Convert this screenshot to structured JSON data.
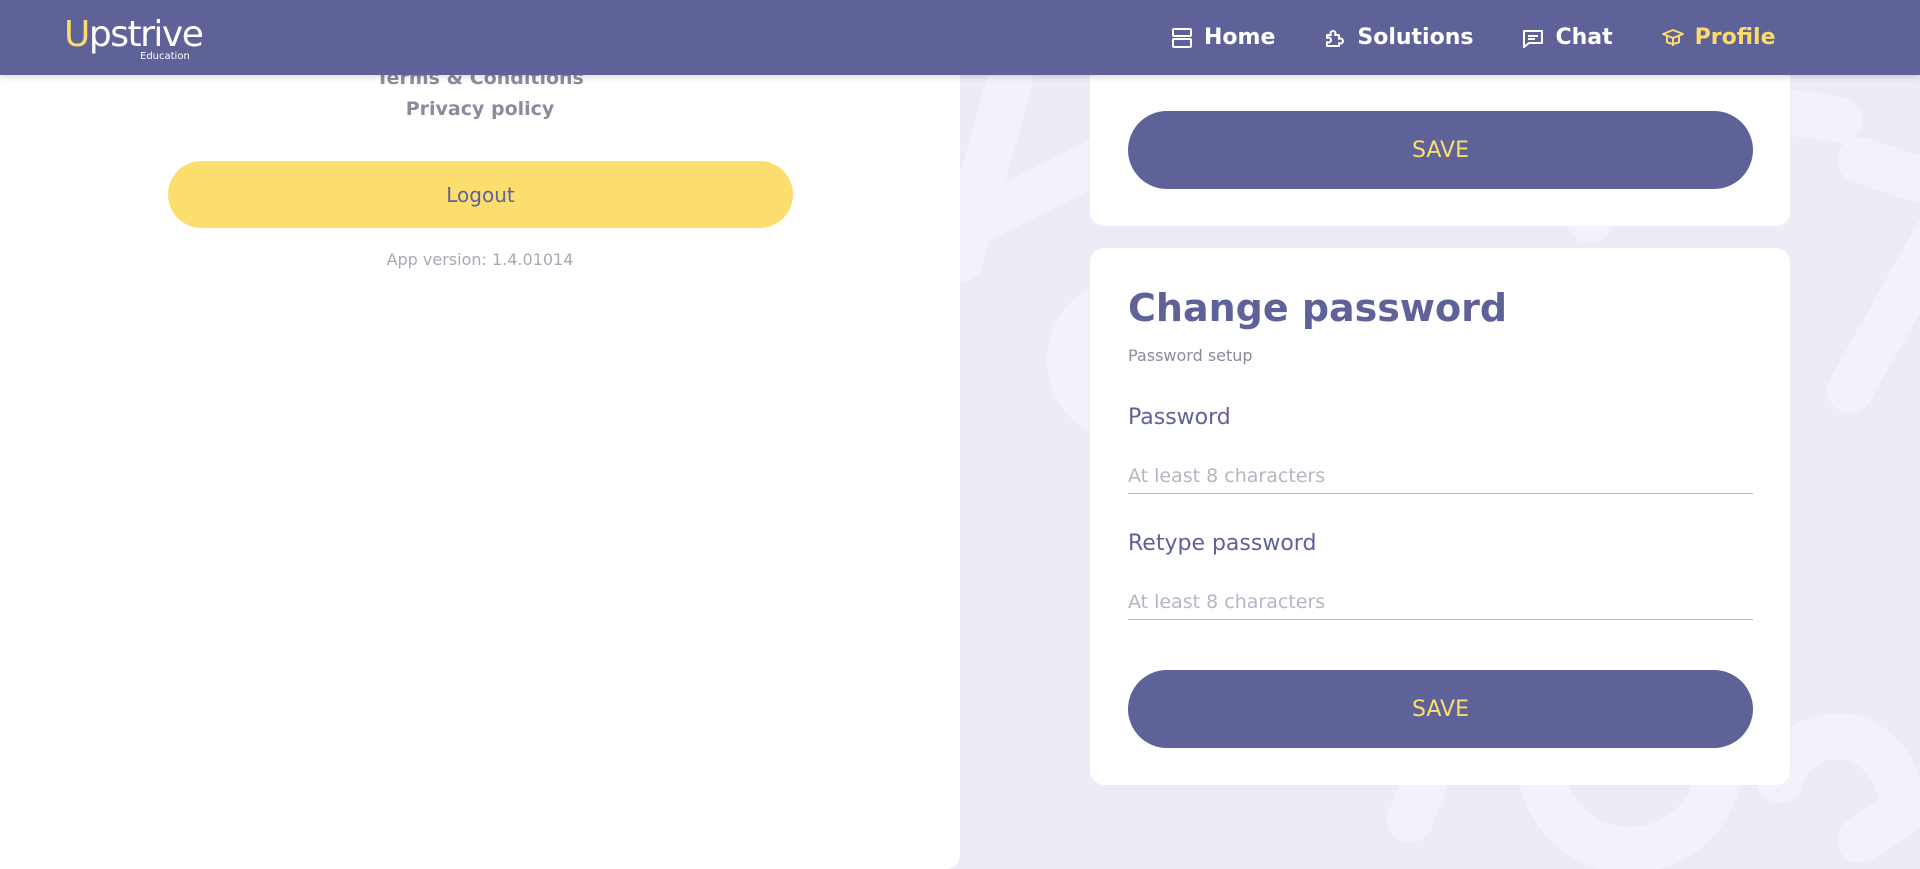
{
  "header": {
    "logo_text": "Upstrive",
    "logo_sub": "Education",
    "nav": [
      {
        "label": "Home",
        "icon": "home-icon"
      },
      {
        "label": "Solutions",
        "icon": "puzzle-icon"
      },
      {
        "label": "Chat",
        "icon": "chat-icon"
      },
      {
        "label": "Profile",
        "icon": "graduation-cap-icon",
        "active": true
      }
    ]
  },
  "left_panel": {
    "terms_label": "Terms & Conditions",
    "privacy_label": "Privacy policy",
    "logout_label": "Logout",
    "app_version": "App version: 1.4.01014"
  },
  "settings_card": {
    "save_label": "SAVE"
  },
  "password_card": {
    "title": "Change password",
    "subtitle": "Password setup",
    "password_label": "Password",
    "password_placeholder": "At least 8 characters",
    "retype_label": "Retype password",
    "retype_placeholder": "At least 8 characters",
    "save_label": "SAVE"
  },
  "colors": {
    "brand_primary": "#5e6299",
    "accent_yellow": "#fcde6e",
    "background": "#ecebf6"
  }
}
